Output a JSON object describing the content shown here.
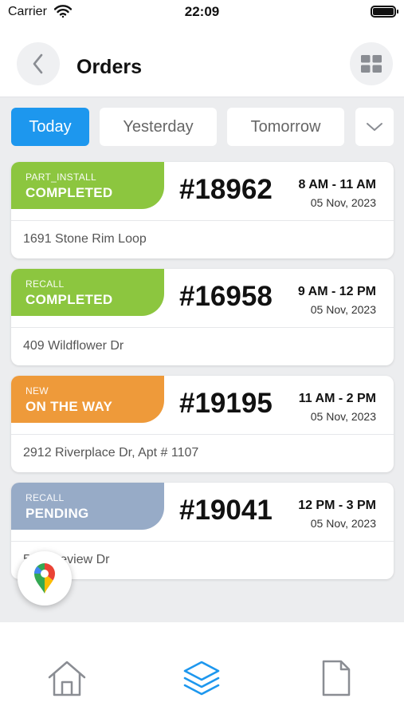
{
  "status_bar": {
    "carrier": "Carrier",
    "time": "22:09"
  },
  "header": {
    "title": "Orders",
    "back_icon": "chevron-left-icon",
    "view_icon": "grid-icon"
  },
  "tabs": [
    {
      "label": "Today",
      "active": true
    },
    {
      "label": "Yesterday",
      "active": false
    },
    {
      "label": "Tomorrow",
      "active": false
    }
  ],
  "colors": {
    "accent": "#1d97ee",
    "completed": "#8cc63f",
    "on_the_way": "#ee9a3a",
    "pending": "#97abc7"
  },
  "orders": [
    {
      "type": "PART_INSTALL",
      "status": "COMPLETED",
      "number": "#18962",
      "slot": "8 AM - 11 AM",
      "date": "05 Nov, 2023",
      "address": "1691 Stone Rim Loop"
    },
    {
      "type": "RECALL",
      "status": "COMPLETED",
      "number": "#16958",
      "slot": "9 AM - 12 PM",
      "date": "05 Nov, 2023",
      "address": "409 Wildflower Dr"
    },
    {
      "type": "NEW",
      "status": "ON THE WAY",
      "number": "#19195",
      "slot": "11 AM - 2 PM",
      "date": "05 Nov, 2023",
      "address": "2912 Riverplace Dr, Apt # 1107"
    },
    {
      "type": "RECALL",
      "status": "PENDING",
      "number": "#19041",
      "slot": "12 PM - 3 PM",
      "date": "05 Nov, 2023",
      "address": "5 Ridgeview Dr"
    }
  ],
  "fab": {
    "icon": "map-pin-icon"
  },
  "bottom_nav": [
    {
      "icon": "home-icon",
      "active": false
    },
    {
      "icon": "layers-icon",
      "active": true
    },
    {
      "icon": "document-icon",
      "active": false
    }
  ]
}
